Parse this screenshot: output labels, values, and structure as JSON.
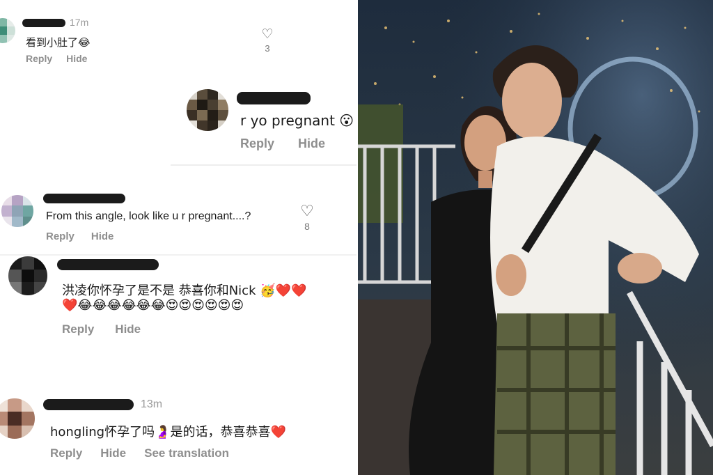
{
  "comments": [
    {
      "text": "看到小肚了😂",
      "time": "17m",
      "likes": "3",
      "reply_label": "Reply",
      "hide_label": "Hide"
    },
    {
      "text": "r yo pregnant 😮",
      "reply_label": "Reply",
      "hide_label": "Hide"
    },
    {
      "text": "From this angle, look like u r pregnant....?",
      "likes": "8",
      "reply_label": "Reply",
      "hide_label": "Hide"
    },
    {
      "text_line1": "洪凌你怀孕了是不是 恭喜你和Nick 🥳❤️❤️",
      "text_line2": "❤️😂😂😂😂😂😂😍😍😍😍😍😍",
      "reply_label": "Reply",
      "hide_label": "Hide"
    },
    {
      "text": "hongling怀孕了吗🤰是的话，恭喜恭喜❤️",
      "time": "13m",
      "reply_label": "Reply",
      "hide_label": "Hide",
      "translate_label": "See translation"
    }
  ],
  "icons": {
    "like": "heart-outline-icon"
  },
  "colors": {
    "redaction": "#1b1b1b",
    "meta_text": "#8e8e8e",
    "photo_sky": "#182230"
  }
}
